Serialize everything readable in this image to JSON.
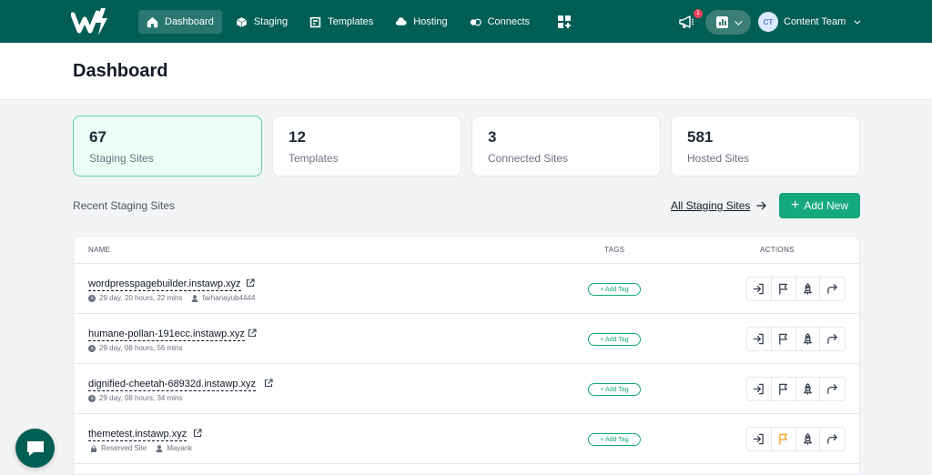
{
  "nav": {
    "items": [
      {
        "label": "Dashboard",
        "icon": "home-icon",
        "active": true
      },
      {
        "label": "Staging",
        "icon": "cube-icon"
      },
      {
        "label": "Templates",
        "icon": "template-icon"
      },
      {
        "label": "Hosting",
        "icon": "cloud-icon"
      },
      {
        "label": "Connects",
        "icon": "connect-icon"
      }
    ],
    "notification_count": "1",
    "user_initials": "CT",
    "user_name": "Content Team"
  },
  "page": {
    "title": "Dashboard"
  },
  "stats": [
    {
      "value": "67",
      "label": "Staging Sites",
      "active": true
    },
    {
      "value": "12",
      "label": "Templates"
    },
    {
      "value": "3",
      "label": "Connected Sites"
    },
    {
      "value": "581",
      "label": "Hosted Sites"
    }
  ],
  "recent": {
    "title": "Recent Staging Sites",
    "all_link": "All Staging Sites",
    "add_new": "Add New"
  },
  "table": {
    "headers": {
      "name": "NAME",
      "tags": "TAGS",
      "actions": "ACTIONS"
    },
    "add_tag_label": "+ Add Tag",
    "rows": [
      {
        "site": "wordpresspagebuilder.instawp.xyz",
        "meta1": "29 day, 20 hours, 22 mins",
        "meta1_icon": "clock-icon",
        "meta2": "farhanayub4444",
        "meta2_icon": "user-icon"
      },
      {
        "site": "humane-pollan-191ecc.instawp.xyz",
        "meta1": "29 day, 08 hours, 56 mins",
        "meta1_icon": "clock-icon"
      },
      {
        "site": "dignified-cheetah-68932d.instawp.xyz",
        "meta1": "29 day, 08 hours, 34 mins",
        "meta1_icon": "clock-icon"
      },
      {
        "site": "themetest.instawp.xyz",
        "meta1": "Reserved Site",
        "meta1_icon": "lock-icon",
        "meta2": "Mayank",
        "meta2_icon": "user-icon",
        "flag_color": "#f5a524"
      }
    ]
  },
  "colors": {
    "brand": "#005e54",
    "accent": "#14a87a",
    "badge": "#f43f5e"
  }
}
